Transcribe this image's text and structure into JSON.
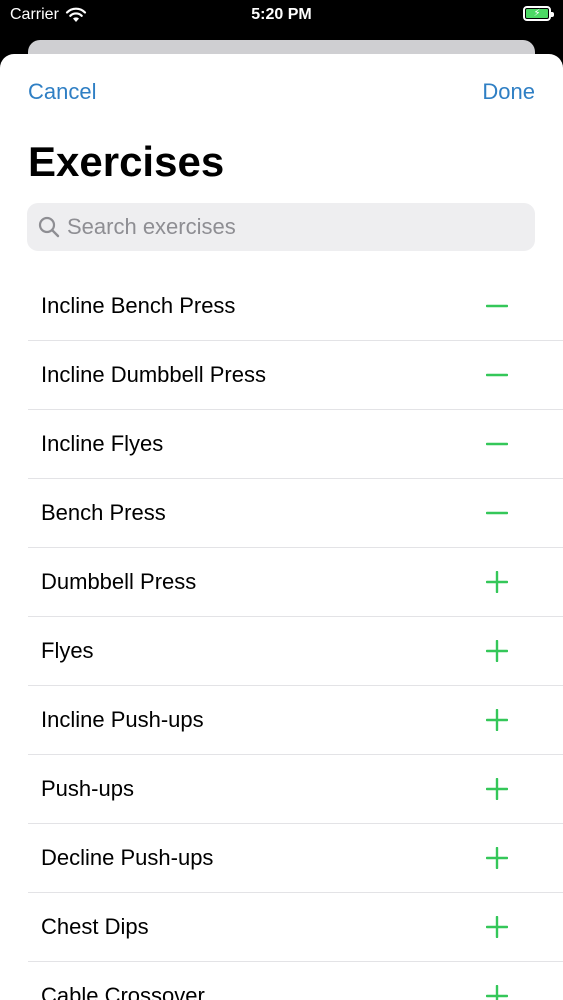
{
  "status_bar": {
    "carrier": "Carrier",
    "time": "5:20 PM"
  },
  "nav": {
    "cancel_label": "Cancel",
    "done_label": "Done"
  },
  "page": {
    "title": "Exercises"
  },
  "search": {
    "placeholder": "Search exercises",
    "value": ""
  },
  "colors": {
    "accent": "#2f7fc4",
    "action": "#34c759"
  },
  "exercises": [
    {
      "label": "Incline Bench Press",
      "icon": "minus-icon"
    },
    {
      "label": "Incline Dumbbell Press",
      "icon": "minus-icon"
    },
    {
      "label": "Incline Flyes",
      "icon": "minus-icon"
    },
    {
      "label": "Bench Press",
      "icon": "minus-icon"
    },
    {
      "label": "Dumbbell Press",
      "icon": "plus-icon"
    },
    {
      "label": "Flyes",
      "icon": "plus-icon"
    },
    {
      "label": "Incline Push-ups",
      "icon": "plus-icon"
    },
    {
      "label": "Push-ups",
      "icon": "plus-icon"
    },
    {
      "label": "Decline Push-ups",
      "icon": "plus-icon"
    },
    {
      "label": "Chest Dips",
      "icon": "plus-icon"
    },
    {
      "label": "Cable Crossover",
      "icon": "plus-icon"
    }
  ]
}
